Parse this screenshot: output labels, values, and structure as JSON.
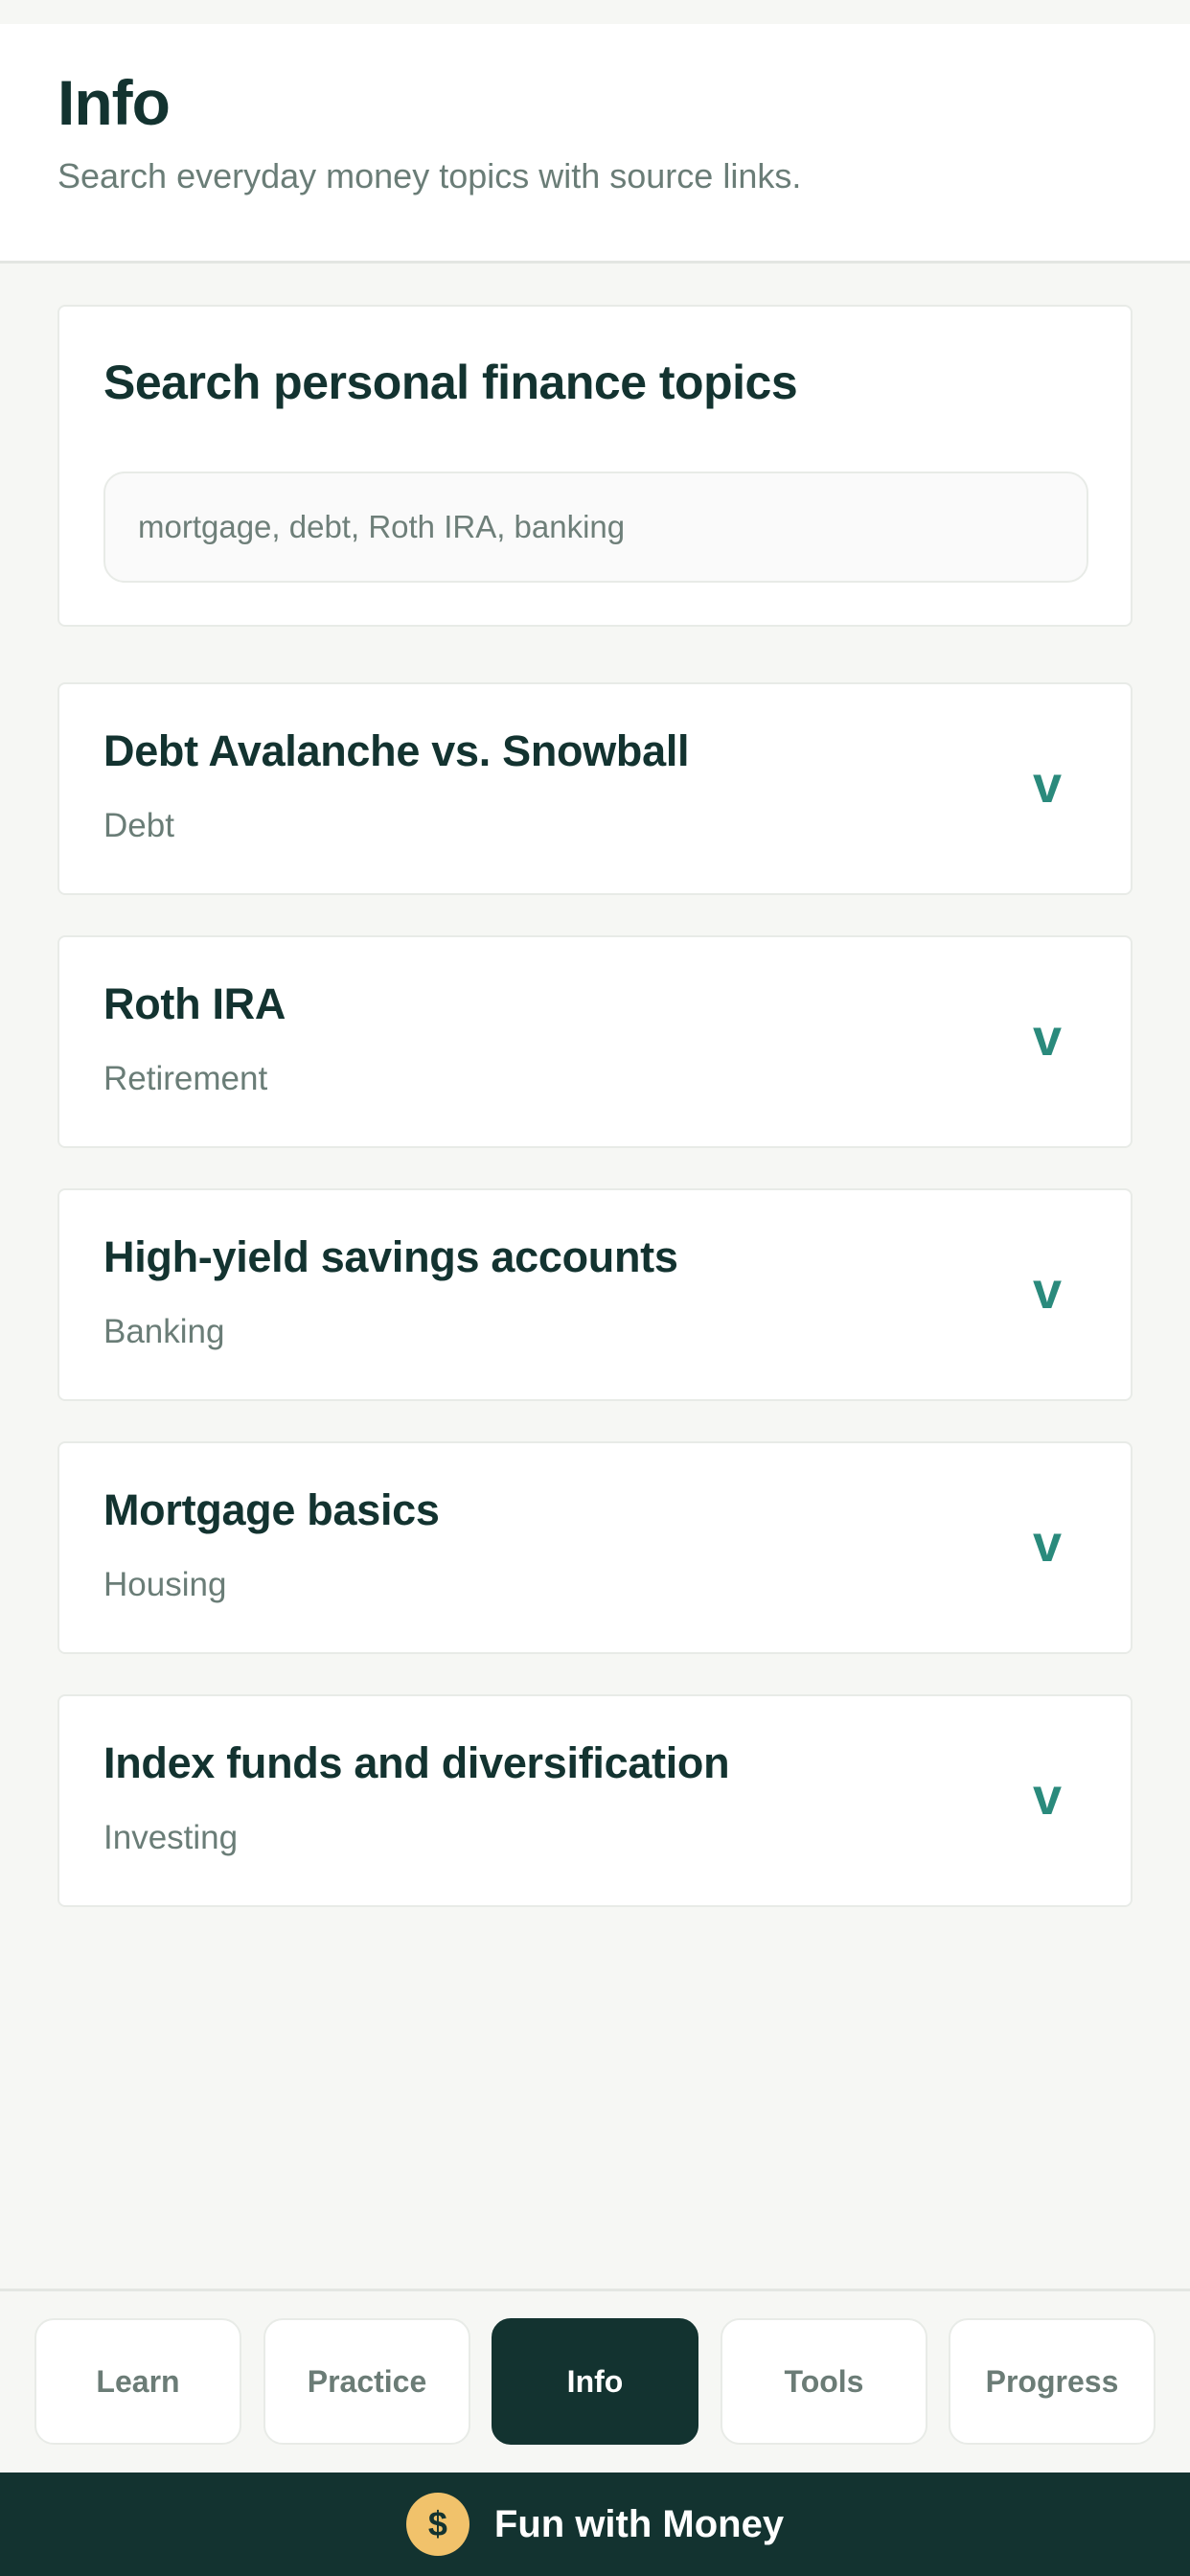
{
  "header": {
    "title": "Info",
    "subtitle": "Search everyday money topics with source links."
  },
  "search": {
    "title": "Search personal finance topics",
    "placeholder": "mortgage, debt, Roth IRA, banking",
    "value": ""
  },
  "topics": [
    {
      "title": "Debt Avalanche vs. Snowball",
      "category": "Debt",
      "expand_glyph": "v"
    },
    {
      "title": "Roth IRA",
      "category": "Retirement",
      "expand_glyph": "v"
    },
    {
      "title": "High-yield savings accounts",
      "category": "Banking",
      "expand_glyph": "v"
    },
    {
      "title": "Mortgage basics",
      "category": "Housing",
      "expand_glyph": "v"
    },
    {
      "title": "Index funds and diversification",
      "category": "Investing",
      "expand_glyph": "v"
    }
  ],
  "nav": {
    "active": "Info",
    "tabs": [
      {
        "label": "Learn"
      },
      {
        "label": "Practice"
      },
      {
        "label": "Info"
      },
      {
        "label": "Tools"
      },
      {
        "label": "Progress"
      }
    ]
  },
  "footer": {
    "coin_symbol": "$",
    "coin_icon": "dollar-coin-icon",
    "brand": "Fun with Money"
  },
  "colors": {
    "primary_dark": "#133330",
    "accent_teal": "#2a8a7c",
    "coin_gold": "#f1c26b",
    "muted_text": "#6a7d77",
    "background": "#f6f7f4"
  }
}
